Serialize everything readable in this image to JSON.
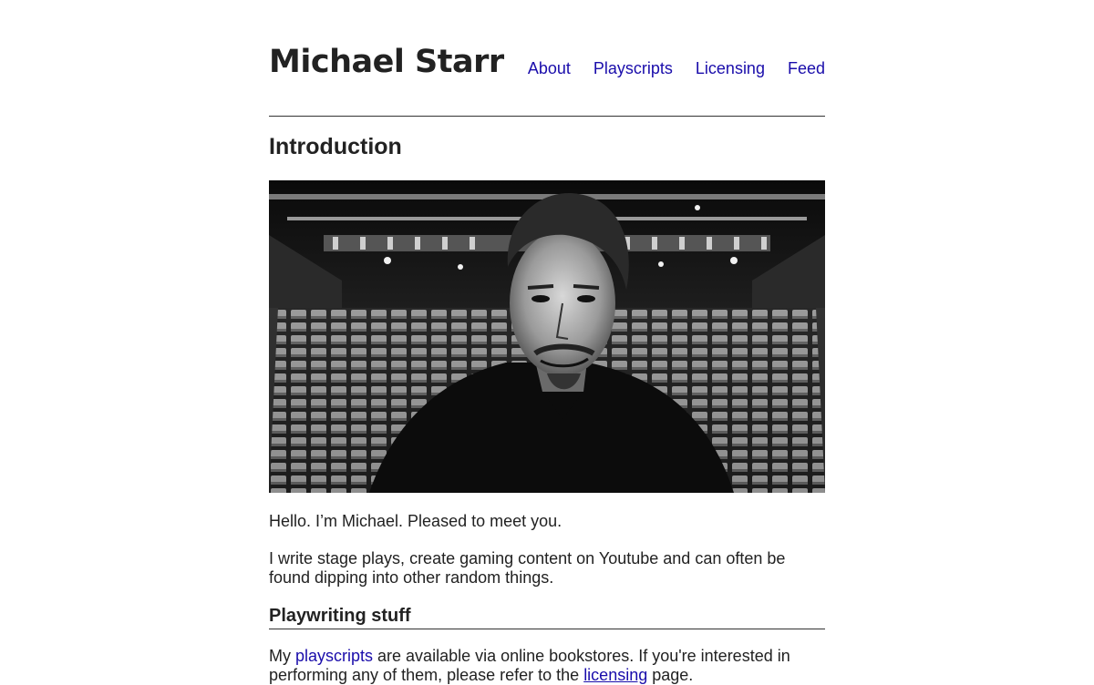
{
  "site": {
    "title": "Michael Starr"
  },
  "nav": {
    "items": [
      {
        "label": "About"
      },
      {
        "label": "Playscripts"
      },
      {
        "label": "Licensing"
      },
      {
        "label": "Feed"
      }
    ]
  },
  "intro": {
    "heading": "Introduction",
    "greeting": "Hello. I’m Michael. Pleased to meet you.",
    "bio": "I write stage plays, create gaming content on Youtube and can often be found dipping into other random things."
  },
  "playwriting": {
    "heading": "Playwriting stuff",
    "p_start": "My ",
    "link_playscripts": "playscripts",
    "p_middle": " are available via online bookstores. If you're interested in performing any of them, please refer to the ",
    "link_licensing": "licensing",
    "p_end": " page."
  }
}
